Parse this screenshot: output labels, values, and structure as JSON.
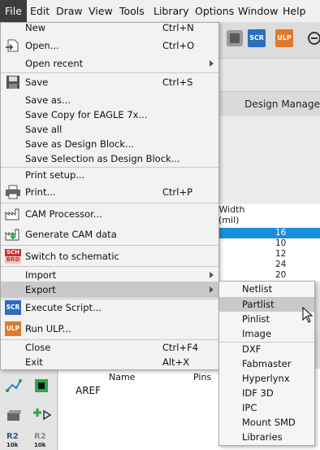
{
  "menubar": {
    "items": [
      "File",
      "Edit",
      "Draw",
      "View",
      "Tools",
      "Library",
      "Options",
      "Window",
      "Help"
    ]
  },
  "toolbar": {
    "scr_label": "SCR",
    "ulp_label": "ULP"
  },
  "background": {
    "design_manager_label": "Design Manage",
    "grid_header_line1": "n Width",
    "grid_header_line2": "(mil)",
    "grid_values": [
      "16",
      "10",
      "12",
      "24",
      "20"
    ],
    "selected_row": 0,
    "col_name": "Name",
    "col_pins": "Pins",
    "row_aref": "AREF",
    "r2_label_1": "R2",
    "r2_sub_1": "10k",
    "r2_label_2": "R2",
    "r2_sub_2": "10k"
  },
  "file_menu": {
    "new": {
      "label": "New",
      "shortcut": "Ctrl+N"
    },
    "open": {
      "label": "Open...",
      "shortcut": "Ctrl+O"
    },
    "open_recent": {
      "label": "Open recent"
    },
    "save": {
      "label": "Save",
      "shortcut": "Ctrl+S"
    },
    "save_as": {
      "label": "Save as..."
    },
    "save_copy": {
      "label": "Save Copy for EAGLE 7x..."
    },
    "save_all": {
      "label": "Save all"
    },
    "save_design_block": {
      "label": "Save as Design Block..."
    },
    "save_selection": {
      "label": "Save Selection as Design Block..."
    },
    "print_setup": {
      "label": "Print setup..."
    },
    "print": {
      "label": "Print...",
      "shortcut": "Ctrl+P"
    },
    "cam_processor": {
      "label": "CAM Processor..."
    },
    "generate_cam": {
      "label": "Generate CAM data"
    },
    "switch_schematic": {
      "label": "Switch to schematic"
    },
    "import": {
      "label": "Import"
    },
    "export": {
      "label": "Export"
    },
    "execute_script": {
      "label": "Execute Script..."
    },
    "run_ulp": {
      "label": "Run ULP..."
    },
    "close": {
      "label": "Close",
      "shortcut": "Ctrl+F4"
    },
    "exit": {
      "label": "Exit",
      "shortcut": "Alt+X"
    }
  },
  "export_menu": {
    "items": [
      "Netlist",
      "Partlist",
      "Pinlist",
      "Image",
      "DXF",
      "Fabmaster",
      "Hyperlynx",
      "IDF 3D",
      "IPC",
      "Mount SMD",
      "Libraries"
    ],
    "highlighted": "Partlist"
  },
  "icons": {
    "sch_top": "SCH",
    "sch_bottom": "BRD",
    "scr": "SCR",
    "ulp": "ULP"
  },
  "colors": {
    "menu_highlight": "#c9c9c9",
    "file_active": "#3d3d3d",
    "selection_blue": "#1a8fd8",
    "scr_blue": "#2a6ebd",
    "ulp_orange": "#e07a2a"
  }
}
